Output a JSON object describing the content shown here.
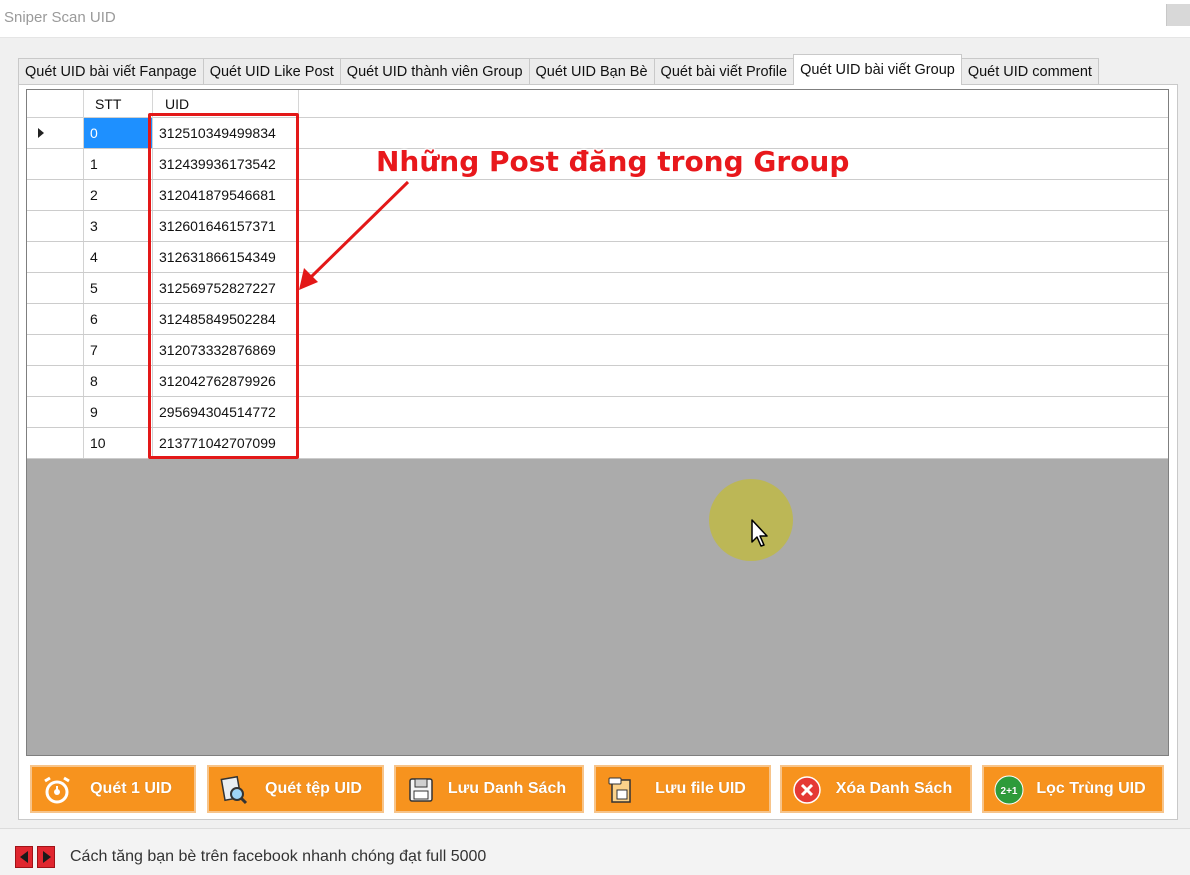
{
  "window": {
    "title": "Sniper Scan UID"
  },
  "tabs": [
    {
      "label": "Quét UID bài viết Fanpage",
      "active": false
    },
    {
      "label": "Quét UID Like Post",
      "active": false
    },
    {
      "label": "Quét UID thành viên Group",
      "active": false
    },
    {
      "label": "Quét UID Bạn Bè",
      "active": false
    },
    {
      "label": "Quét bài viết Profile",
      "active": false
    },
    {
      "label": "Quét UID bài viết Group",
      "active": true
    },
    {
      "label": "Quét UID comment",
      "active": false
    }
  ],
  "grid": {
    "columns": {
      "stt": "STT",
      "uid": "UID"
    },
    "rows": [
      {
        "stt": "0",
        "uid": "312510349499834",
        "selected": true
      },
      {
        "stt": "1",
        "uid": "312439936173542"
      },
      {
        "stt": "2",
        "uid": "312041879546681"
      },
      {
        "stt": "3",
        "uid": "312601646157371"
      },
      {
        "stt": "4",
        "uid": "312631866154349"
      },
      {
        "stt": "5",
        "uid": "312569752827227"
      },
      {
        "stt": "6",
        "uid": "312485849502284"
      },
      {
        "stt": "7",
        "uid": "312073332876869"
      },
      {
        "stt": "8",
        "uid": "312042762879926"
      },
      {
        "stt": "9",
        "uid": "295694304514772"
      },
      {
        "stt": "10",
        "uid": "213771042707099"
      }
    ]
  },
  "annotation": {
    "text": "Những Post đăng trong Group",
    "color": "#e8181c"
  },
  "buttons": [
    {
      "label": "Quét 1 UID",
      "icon": "alarm-clock-icon"
    },
    {
      "label": "Quét tệp UID",
      "icon": "file-search-icon"
    },
    {
      "label": "Lưu Danh Sách",
      "icon": "floppy-disk-icon"
    },
    {
      "label": "Lưu file UID",
      "icon": "save-file-icon"
    },
    {
      "label": "Xóa Danh Sách",
      "icon": "close-circle-icon"
    },
    {
      "label": "Lọc Trùng UID",
      "icon": "filter-duplicate-icon",
      "icon_text": "2+1"
    }
  ],
  "status": {
    "text": "Cách tăng bạn bè trên facebook nhanh chóng đạt full 5000"
  },
  "colors": {
    "accent": "#f7931e",
    "selection": "#1e90ff",
    "highlight": "#e31818"
  }
}
